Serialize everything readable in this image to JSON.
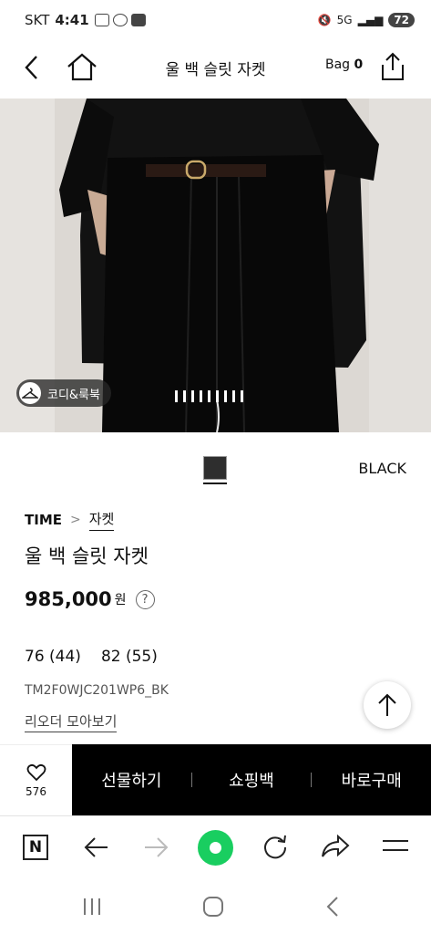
{
  "status_bar": {
    "carrier": "SKT",
    "time": "4:41",
    "battery": "72",
    "network": "5G"
  },
  "header": {
    "title": "울 백 슬릿 자켓",
    "bag_label": "Bag",
    "bag_count": "0"
  },
  "gallery": {
    "codi_label": "코디&룩북",
    "page_count": 9
  },
  "color": {
    "name": "BLACK",
    "swatch": "#2e2e2e"
  },
  "product": {
    "brand": "TIME",
    "category": "자켓",
    "name": "울 백 슬릿 자켓",
    "price": "985,000",
    "currency": "원",
    "help_symbol": "?",
    "sizes": [
      "76 (44)",
      "82 (55)"
    ],
    "code": "TM2F0WJC201WP6_BK",
    "reorder_link": "리오더 모아보기"
  },
  "actions": {
    "like_count": "576",
    "gift": "선물하기",
    "cart": "쇼핑백",
    "buy": "바로구매"
  },
  "browser": {
    "n_label": "N"
  },
  "colors": {
    "accent_green": "#19ce60",
    "action_bar": "#000000"
  }
}
